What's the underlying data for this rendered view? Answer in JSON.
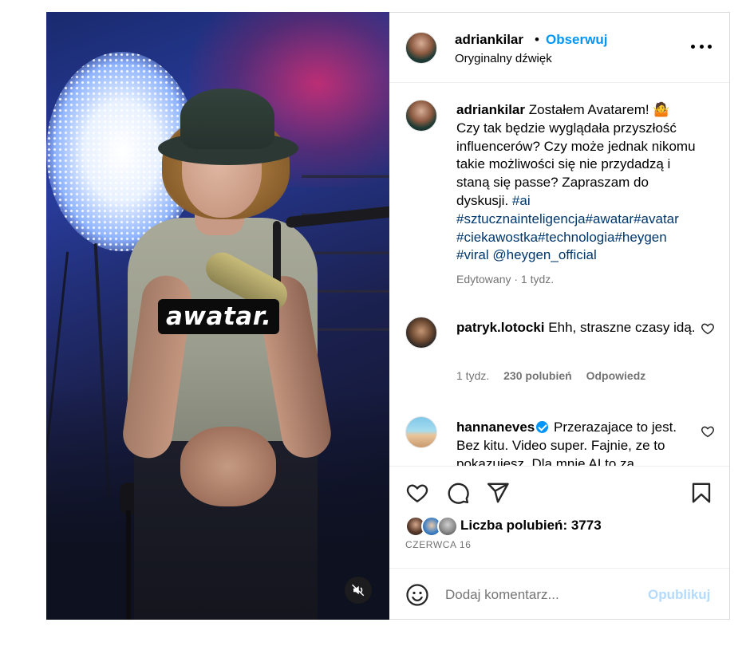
{
  "media": {
    "overlay_caption": "awatar.",
    "mute_icon": "volume-muted-icon"
  },
  "header": {
    "username": "adriankilar",
    "separator": "•",
    "follow_label": "Obserwuj",
    "audio_label": "Oryginalny dźwięk",
    "more_icon": "more-options-icon"
  },
  "caption": {
    "username": "adriankilar",
    "text": "Zostałem Avatarem! 🤷",
    "text2": "Czy tak będzie wyglądała przyszłość influencerów? Czy może jednak nikomu takie możliwości się nie przydadzą i staną się passe? Zapraszam do dyskusji.",
    "hashtags": "#ai #sztucznainteligencja#awatar#avatar #ciekawostka#technologia#heygen #viral",
    "mention": "@heygen_official",
    "meta": "Edytowany · 1 tydz."
  },
  "comments": [
    {
      "username": "patryk.lotocki",
      "text": "Ehh, straszne czasy idą.",
      "time": "1 tydz.",
      "likes": "230 polubień",
      "reply": "Odpowiedz"
    },
    {
      "username": "hannaneves",
      "verified": true,
      "text": "Przerazajace to jest. Bez kitu. Video super. Fajnie, ze to pokazujesz. Dla mnie AI to za"
    }
  ],
  "actions": {
    "icons": [
      "heart-icon",
      "comment-icon",
      "share-icon",
      "bookmark-icon"
    ],
    "likes_label": "Liczba polubień: 3773",
    "date": "CZERWCA 16"
  },
  "add_comment": {
    "placeholder": "Dodaj komentarz...",
    "post_label": "Opublikuj"
  },
  "colors": {
    "accent": "#0095f6",
    "hashtag": "#00376b",
    "muted_text": "#737373",
    "post_disabled": "#b3dbff",
    "border": "#dbdbdb"
  }
}
